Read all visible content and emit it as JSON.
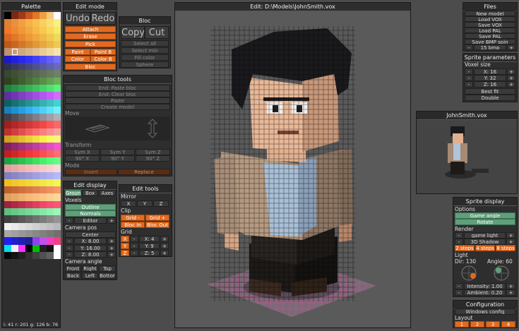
{
  "palette": {
    "title": "Palette",
    "status": "i: 41  r: 201  g: 126  b: 76",
    "colors": [
      "#000000",
      "#7a2a10",
      "#a23a18",
      "#c85820",
      "#e07828",
      "#f0a040",
      "#f8c880",
      "#ffffff",
      "#e08030",
      "#e89040",
      "#f0a040",
      "#f8b048",
      "#f8c050",
      "#f8d060",
      "#f8e070",
      "#f8f080",
      "#f07828",
      "#f08830",
      "#f09838",
      "#f0a840",
      "#f8b848",
      "#f8c850",
      "#f8d858",
      "#f8e868",
      "#d86820",
      "#e07828",
      "#e88830",
      "#f09838",
      "#f0a840",
      "#f0b848",
      "#f0c850",
      "#f0d858",
      "#c05818",
      "#c86820",
      "#d07828",
      "#d88830",
      "#e09838",
      "#e8a840",
      "#e8b848",
      "#f0c850",
      "#c09070",
      "#c89c78",
      "#d0a880",
      "#d8b488",
      "#e0c090",
      "#e8cc98",
      "#f0d8a0",
      "#f8e4a8",
      "#1818d0",
      "#2020e0",
      "#2828f0",
      "#3030f8",
      "#4040f8",
      "#5050f8",
      "#6060f8",
      "#7070f8",
      "#303050",
      "#383860",
      "#404070",
      "#484880",
      "#505090",
      "#5858a0",
      "#6060b0",
      "#6868c0",
      "#384830",
      "#405038",
      "#485840",
      "#506048",
      "#586850",
      "#607058",
      "#687860",
      "#708068",
      "#304020",
      "#385028",
      "#406030",
      "#487038",
      "#508040",
      "#589048",
      "#60a050",
      "#68b058",
      "#208040",
      "#289048",
      "#30a050",
      "#38b058",
      "#40c060",
      "#48d068",
      "#50e070",
      "#58f078",
      "#6030a0",
      "#7038b0",
      "#8040c0",
      "#9048d0",
      "#a050e0",
      "#b058f0",
      "#c060f8",
      "#d070f8",
      "#106060",
      "#187070",
      "#208080",
      "#289090",
      "#30a0a0",
      "#38b0b0",
      "#40c0c0",
      "#48d0d0",
      "#1880c0",
      "#2090d0",
      "#28a0e0",
      "#30b0f0",
      "#40c0f8",
      "#50d0f8",
      "#60e0f8",
      "#70f0f8",
      "#404048",
      "#505058",
      "#606068",
      "#707078",
      "#808088",
      "#909098",
      "#a0a0a8",
      "#b0b0b8",
      "#a02020",
      "#b02828",
      "#c03030",
      "#d03838",
      "#e04040",
      "#f04848",
      "#f85858",
      "#f86868",
      "#c03030",
      "#d04040",
      "#e05050",
      "#f06060",
      "#f87070",
      "#f88080",
      "#f89090",
      "#f8a0a0",
      "#d0a020",
      "#d8b028",
      "#e0c030",
      "#e8d038",
      "#f0e040",
      "#f8f048",
      "#f8f860",
      "#f8f878",
      "#802060",
      "#902870",
      "#a03080",
      "#b03890",
      "#c040a0",
      "#d048b0",
      "#e050c0",
      "#f058d0",
      "#c02020",
      "#d02828",
      "#e03030",
      "#f03838",
      "#f84040",
      "#f85050",
      "#f86060",
      "#f87070",
      "#20a040",
      "#28b048",
      "#30c050",
      "#38d058",
      "#40e060",
      "#48f068",
      "#58f878",
      "#68f888",
      "#e0a0a0",
      "#e8a8a8",
      "#f0b0b0",
      "#f8b8b8",
      "#f8c0c0",
      "#f8c8c8",
      "#f8d0d0",
      "#f8d8d8",
      "#8080c0",
      "#8888c8",
      "#9090d0",
      "#9898d8",
      "#a0a0e0",
      "#a8a8e8",
      "#b0b0f0",
      "#b8b8f8",
      "#f0c020",
      "#f0c828",
      "#f0d030",
      "#f0d838",
      "#f0e040",
      "#f0e848",
      "#f0f050",
      "#f0f858",
      "#c06030",
      "#c86838",
      "#d07040",
      "#d87848",
      "#e08050",
      "#e88858",
      "#f09060",
      "#f89868",
      "#e0a060",
      "#e8a868",
      "#f0b070",
      "#f8b878",
      "#f8c080",
      "#f8c888",
      "#f8d090",
      "#f8d898",
      "#a02040",
      "#b02848",
      "#c03050",
      "#d03858",
      "#e04060",
      "#f04868",
      "#f85070",
      "#f85878",
      "#60c080",
      "#68c888",
      "#70d090",
      "#78d898",
      "#80e0a0",
      "#88e8a8",
      "#90f0b0",
      "#98f8b8",
      "#404040",
      "#4c4c4c",
      "#585858",
      "#646464",
      "#707070",
      "#7c7c7c",
      "#888888",
      "#949494",
      "#f0f0f0",
      "#e8e8e8",
      "#e0e0e0",
      "#d8d8d8",
      "#d0d0d0",
      "#c8c8c8",
      "#c0c0c0",
      "#b8b8b8",
      "#a8a8a8",
      "#a0a0a0",
      "#989898",
      "#909090",
      "#888888",
      "#808080",
      "#787878",
      "#707070",
      "#2020f0",
      "#2020d0",
      "#2020b0",
      "#202090",
      "#9040f0",
      "#c050f0",
      "#f040c0",
      "#f04080",
      "#00e0f0",
      "#f0f0f0",
      "#ff30ff",
      "#000000",
      "#00c000",
      "#202020",
      "#101010",
      "#ffffff",
      "#080808",
      "#141414",
      "#202020",
      "#303030",
      "#404040",
      "#505050",
      "#606060",
      "#ffffff"
    ]
  },
  "edit_mode": {
    "title": "Edit mode",
    "undo": "Undo",
    "redo": "Redo",
    "attach": "Attach",
    "erase": "Erase",
    "pick": "Pick",
    "paint": "Paint",
    "paint_b": "Paint B",
    "color": "Color",
    "color_b": "Color B",
    "bloc": "Bloc"
  },
  "bloc": {
    "title": "Bloc",
    "copy": "Copy",
    "cut": "Cut",
    "select_all": "Select all",
    "select_min": "Select min",
    "fill_color": "Fill color",
    "sphere": "Sphere"
  },
  "bloc_tools": {
    "title": "Bloc tools",
    "end_paste": "End: Paste bloc",
    "end_clear": "End: Clear bloc",
    "paste": "Paste",
    "create_model": "Create model",
    "move": "Move",
    "transform": "Transform",
    "sym_x": "Sym X",
    "sym_y": "Sym Y",
    "sym_z": "Sym Z",
    "rot_x": "90° X",
    "rot_y": "90° Y",
    "rot_z": "90° Z",
    "mode": "Mode",
    "insert": "Insert",
    "replace": "Replace"
  },
  "edit_display": {
    "title": "Edit display",
    "ground": "Ground",
    "box": "Box",
    "axes": "Axes",
    "voxels": "Voxels",
    "outline": "Outline",
    "normals": "Normals",
    "editor": "Editor",
    "camera_pos": "Camera pos",
    "center": "Center",
    "cam_x": "X: 8.00",
    "cam_y": "Y: 16.00",
    "cam_z": "Z: 8.00",
    "camera_angle": "Camera angle",
    "front": "Front",
    "right": "Right",
    "top": "Top",
    "back": "Back",
    "left": "Left",
    "bottom": "Bottom",
    "minus": "-",
    "plus": "+"
  },
  "edit_tools": {
    "title": "Edit tools",
    "mirror": "Mirror",
    "x": "X",
    "y": "Y",
    "z": "Z",
    "clip": "Clip",
    "grid_minus": "Grid -",
    "grid_plus": "Grid +",
    "bloc_in": "Bloc In",
    "bloc_out": "Bloc Out",
    "grid": "Grid",
    "gx": "X: 4",
    "gy": "Y: 9",
    "gz": "Z: 5",
    "minus": "-",
    "plus": "+"
  },
  "viewport": {
    "title": "Edit: D:\\Models\\JohnSmith.vox"
  },
  "files": {
    "title": "Files",
    "new_model": "New model",
    "load_vox": "Load VOX",
    "save_vox": "Save VOX",
    "load_pal": "Load PAL",
    "save_pal": "Save PAL",
    "save_bmp_spin": "Save BMP spin",
    "bmp": "15 bmp",
    "minus": "-",
    "plus": "+"
  },
  "sprite_params": {
    "title": "Sprite parameters",
    "voxel_size": "Voxel size",
    "x": "X: 16",
    "y": "Y: 32",
    "z": "Z: 16",
    "best_fit": "Best fit",
    "double": "Double",
    "minus": "-",
    "plus": "+"
  },
  "preview": {
    "title": "JohnSmith.vox"
  },
  "sprite_display": {
    "title": "Sprite display",
    "options": "Options",
    "game_angle": "Game angle",
    "rotate": "Rotate",
    "render": "Render",
    "game_light": "game light",
    "shadow_3d": "3D Shadow",
    "steps2": "2 steps",
    "steps4": "4 steps",
    "steps8": "8 steps",
    "light": "Light",
    "dir": "Dir: 130",
    "angle": "Angle: 60",
    "intensity": "Intensity: 1.00",
    "ambient": "Ambient: 0.20",
    "minus": "-",
    "plus": "+"
  },
  "configuration": {
    "title": "Configuration",
    "windows_config": "Windows config",
    "layout": "Layout",
    "l1": "1",
    "l2": "2",
    "l3": "3",
    "l4": "4"
  }
}
